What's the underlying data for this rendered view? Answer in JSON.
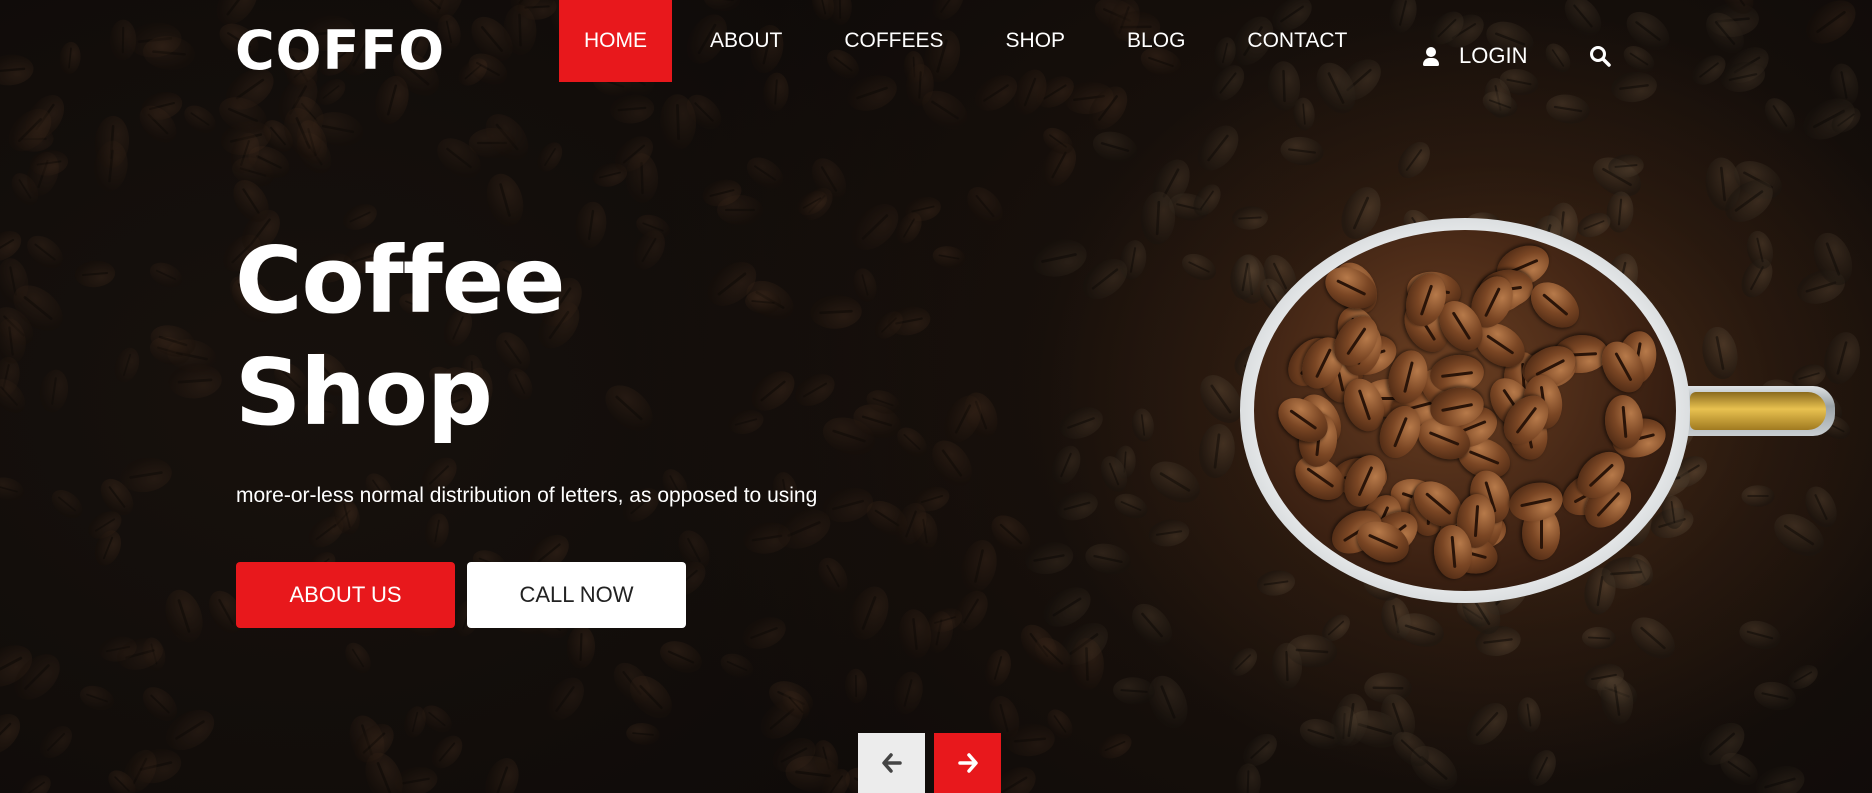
{
  "brand": {
    "logo": "COFFO"
  },
  "nav": {
    "items": [
      {
        "label": "HOME",
        "active": true
      },
      {
        "label": "ABOUT",
        "active": false
      },
      {
        "label": "COFFEES",
        "active": false
      },
      {
        "label": "SHOP",
        "active": false
      },
      {
        "label": "BLOG",
        "active": false
      },
      {
        "label": "CONTACT",
        "active": false
      }
    ],
    "login_label": "LOGIN",
    "login_icon": "user-icon",
    "search_icon": "search-icon"
  },
  "hero": {
    "title_line1": "Coffee",
    "title_line2": "Shop",
    "subtitle": "more-or-less normal distribution of letters, as opposed to using",
    "primary_button": "ABOUT US",
    "secondary_button": "CALL NOW"
  },
  "slider": {
    "prev_icon": "arrow-left-icon",
    "next_icon": "arrow-right-icon"
  },
  "colors": {
    "accent": "#e8181c",
    "background": "#1a120d",
    "text": "#ffffff"
  }
}
